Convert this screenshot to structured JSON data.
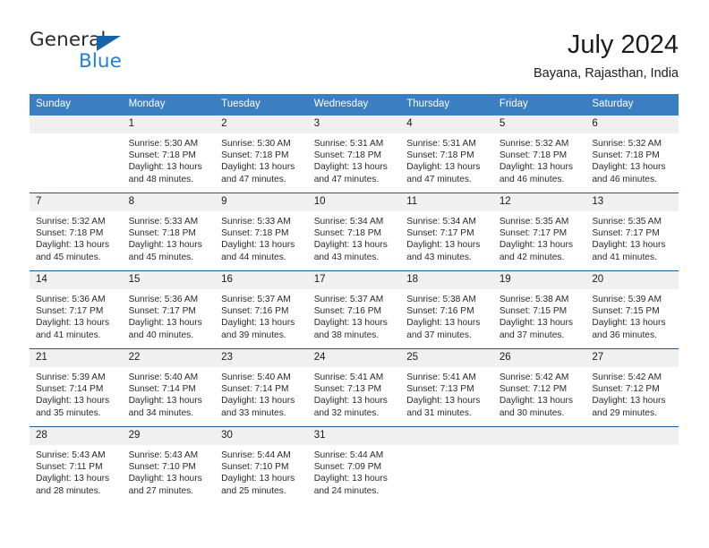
{
  "brand": {
    "name_part1": "General",
    "name_part2": "Blue",
    "triangle_icon": "triangle-icon",
    "accent_color": "#2281d2",
    "triangle_color": "#1464aa"
  },
  "header": {
    "title": "July 2024",
    "subtitle": "Bayana, Rajasthan, India"
  },
  "calendar": {
    "header_bg": "#3a7fc1",
    "row_divider_color": "#185a96",
    "daynum_bg": "#f0f0f0",
    "weekdays": [
      "Sunday",
      "Monday",
      "Tuesday",
      "Wednesday",
      "Thursday",
      "Friday",
      "Saturday"
    ],
    "weeks": [
      [
        {
          "day": "",
          "sunrise": "",
          "sunset": "",
          "daylight": ""
        },
        {
          "day": "1",
          "sunrise": "Sunrise: 5:30 AM",
          "sunset": "Sunset: 7:18 PM",
          "daylight": "Daylight: 13 hours and 48 minutes."
        },
        {
          "day": "2",
          "sunrise": "Sunrise: 5:30 AM",
          "sunset": "Sunset: 7:18 PM",
          "daylight": "Daylight: 13 hours and 47 minutes."
        },
        {
          "day": "3",
          "sunrise": "Sunrise: 5:31 AM",
          "sunset": "Sunset: 7:18 PM",
          "daylight": "Daylight: 13 hours and 47 minutes."
        },
        {
          "day": "4",
          "sunrise": "Sunrise: 5:31 AM",
          "sunset": "Sunset: 7:18 PM",
          "daylight": "Daylight: 13 hours and 47 minutes."
        },
        {
          "day": "5",
          "sunrise": "Sunrise: 5:32 AM",
          "sunset": "Sunset: 7:18 PM",
          "daylight": "Daylight: 13 hours and 46 minutes."
        },
        {
          "day": "6",
          "sunrise": "Sunrise: 5:32 AM",
          "sunset": "Sunset: 7:18 PM",
          "daylight": "Daylight: 13 hours and 46 minutes."
        }
      ],
      [
        {
          "day": "7",
          "sunrise": "Sunrise: 5:32 AM",
          "sunset": "Sunset: 7:18 PM",
          "daylight": "Daylight: 13 hours and 45 minutes."
        },
        {
          "day": "8",
          "sunrise": "Sunrise: 5:33 AM",
          "sunset": "Sunset: 7:18 PM",
          "daylight": "Daylight: 13 hours and 45 minutes."
        },
        {
          "day": "9",
          "sunrise": "Sunrise: 5:33 AM",
          "sunset": "Sunset: 7:18 PM",
          "daylight": "Daylight: 13 hours and 44 minutes."
        },
        {
          "day": "10",
          "sunrise": "Sunrise: 5:34 AM",
          "sunset": "Sunset: 7:18 PM",
          "daylight": "Daylight: 13 hours and 43 minutes."
        },
        {
          "day": "11",
          "sunrise": "Sunrise: 5:34 AM",
          "sunset": "Sunset: 7:17 PM",
          "daylight": "Daylight: 13 hours and 43 minutes."
        },
        {
          "day": "12",
          "sunrise": "Sunrise: 5:35 AM",
          "sunset": "Sunset: 7:17 PM",
          "daylight": "Daylight: 13 hours and 42 minutes."
        },
        {
          "day": "13",
          "sunrise": "Sunrise: 5:35 AM",
          "sunset": "Sunset: 7:17 PM",
          "daylight": "Daylight: 13 hours and 41 minutes."
        }
      ],
      [
        {
          "day": "14",
          "sunrise": "Sunrise: 5:36 AM",
          "sunset": "Sunset: 7:17 PM",
          "daylight": "Daylight: 13 hours and 41 minutes."
        },
        {
          "day": "15",
          "sunrise": "Sunrise: 5:36 AM",
          "sunset": "Sunset: 7:17 PM",
          "daylight": "Daylight: 13 hours and 40 minutes."
        },
        {
          "day": "16",
          "sunrise": "Sunrise: 5:37 AM",
          "sunset": "Sunset: 7:16 PM",
          "daylight": "Daylight: 13 hours and 39 minutes."
        },
        {
          "day": "17",
          "sunrise": "Sunrise: 5:37 AM",
          "sunset": "Sunset: 7:16 PM",
          "daylight": "Daylight: 13 hours and 38 minutes."
        },
        {
          "day": "18",
          "sunrise": "Sunrise: 5:38 AM",
          "sunset": "Sunset: 7:16 PM",
          "daylight": "Daylight: 13 hours and 37 minutes."
        },
        {
          "day": "19",
          "sunrise": "Sunrise: 5:38 AM",
          "sunset": "Sunset: 7:15 PM",
          "daylight": "Daylight: 13 hours and 37 minutes."
        },
        {
          "day": "20",
          "sunrise": "Sunrise: 5:39 AM",
          "sunset": "Sunset: 7:15 PM",
          "daylight": "Daylight: 13 hours and 36 minutes."
        }
      ],
      [
        {
          "day": "21",
          "sunrise": "Sunrise: 5:39 AM",
          "sunset": "Sunset: 7:14 PM",
          "daylight": "Daylight: 13 hours and 35 minutes."
        },
        {
          "day": "22",
          "sunrise": "Sunrise: 5:40 AM",
          "sunset": "Sunset: 7:14 PM",
          "daylight": "Daylight: 13 hours and 34 minutes."
        },
        {
          "day": "23",
          "sunrise": "Sunrise: 5:40 AM",
          "sunset": "Sunset: 7:14 PM",
          "daylight": "Daylight: 13 hours and 33 minutes."
        },
        {
          "day": "24",
          "sunrise": "Sunrise: 5:41 AM",
          "sunset": "Sunset: 7:13 PM",
          "daylight": "Daylight: 13 hours and 32 minutes."
        },
        {
          "day": "25",
          "sunrise": "Sunrise: 5:41 AM",
          "sunset": "Sunset: 7:13 PM",
          "daylight": "Daylight: 13 hours and 31 minutes."
        },
        {
          "day": "26",
          "sunrise": "Sunrise: 5:42 AM",
          "sunset": "Sunset: 7:12 PM",
          "daylight": "Daylight: 13 hours and 30 minutes."
        },
        {
          "day": "27",
          "sunrise": "Sunrise: 5:42 AM",
          "sunset": "Sunset: 7:12 PM",
          "daylight": "Daylight: 13 hours and 29 minutes."
        }
      ],
      [
        {
          "day": "28",
          "sunrise": "Sunrise: 5:43 AM",
          "sunset": "Sunset: 7:11 PM",
          "daylight": "Daylight: 13 hours and 28 minutes."
        },
        {
          "day": "29",
          "sunrise": "Sunrise: 5:43 AM",
          "sunset": "Sunset: 7:10 PM",
          "daylight": "Daylight: 13 hours and 27 minutes."
        },
        {
          "day": "30",
          "sunrise": "Sunrise: 5:44 AM",
          "sunset": "Sunset: 7:10 PM",
          "daylight": "Daylight: 13 hours and 25 minutes."
        },
        {
          "day": "31",
          "sunrise": "Sunrise: 5:44 AM",
          "sunset": "Sunset: 7:09 PM",
          "daylight": "Daylight: 13 hours and 24 minutes."
        },
        {
          "day": "",
          "sunrise": "",
          "sunset": "",
          "daylight": ""
        },
        {
          "day": "",
          "sunrise": "",
          "sunset": "",
          "daylight": ""
        },
        {
          "day": "",
          "sunrise": "",
          "sunset": "",
          "daylight": ""
        }
      ]
    ]
  }
}
